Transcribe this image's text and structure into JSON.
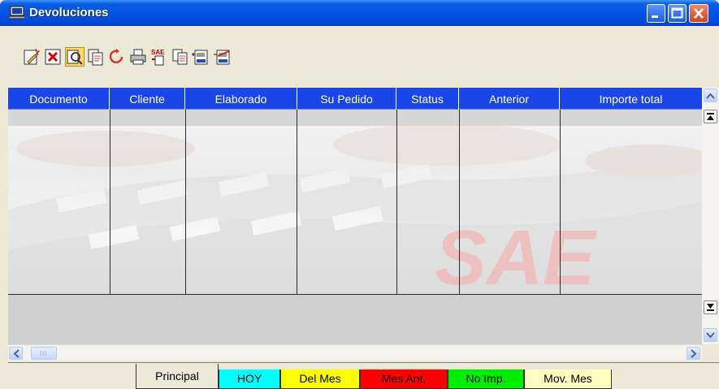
{
  "window": {
    "title": "Devoluciones",
    "title_color": "#0055e5"
  },
  "toolbar": {
    "tools": [
      {
        "icon": "new-document-icon"
      },
      {
        "icon": "delete-icon"
      },
      {
        "icon": "search-icon"
      },
      {
        "icon": "copy-icon"
      },
      {
        "icon": "refresh-icon"
      },
      {
        "icon": "print-icon"
      },
      {
        "icon": "sae-export-icon"
      },
      {
        "icon": "documents-icon"
      },
      {
        "icon": "import-barcode-icon"
      },
      {
        "icon": "cancel-barcode-icon"
      }
    ]
  },
  "grid": {
    "header_color": "#1a45e8",
    "columns": [
      "Documento",
      "Cliente",
      "Elaborado",
      "Su Pedido",
      "Status",
      "Anterior",
      "Importe total"
    ],
    "rows": [],
    "watermark_text": "SAE"
  },
  "tabs": [
    {
      "label": "Principal",
      "color": "#ece9d8",
      "active": true
    },
    {
      "label": "HOY",
      "color": "#00ffff",
      "active": false
    },
    {
      "label": "Del Mes",
      "color": "#ffff00",
      "active": false
    },
    {
      "label": "Mes Ant.",
      "color": "#ff0000",
      "active": false
    },
    {
      "label": "No Imp.",
      "color": "#00ff00",
      "active": false
    },
    {
      "label": "Mov. Mes",
      "color": "#ffffc0",
      "active": false
    }
  ]
}
